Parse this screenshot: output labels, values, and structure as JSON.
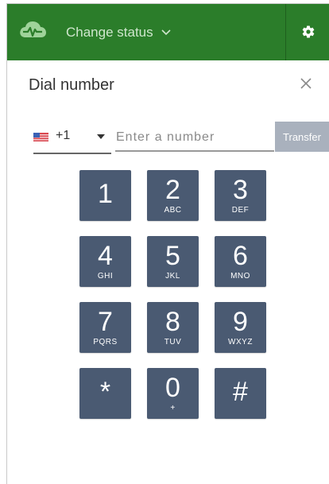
{
  "header": {
    "brand_icon": "cloud-pulse-icon",
    "status_label": "Change status",
    "status_icon": "chevron-down-icon",
    "settings_icon": "gear-icon",
    "accent_color": "#2b7d2a"
  },
  "dialer": {
    "title": "Dial number",
    "close_icon": "close-icon",
    "country_flag": "us-flag-icon",
    "country_code": "+1",
    "number_value": "",
    "number_placeholder": "Enter a number",
    "transfer_label": "Transfer",
    "key_color": "#4a5a72",
    "keys": [
      {
        "digit": "1",
        "letters": ""
      },
      {
        "digit": "2",
        "letters": "ABC"
      },
      {
        "digit": "3",
        "letters": "DEF"
      },
      {
        "digit": "4",
        "letters": "GHI"
      },
      {
        "digit": "5",
        "letters": "JKL"
      },
      {
        "digit": "6",
        "letters": "MNO"
      },
      {
        "digit": "7",
        "letters": "PQRS"
      },
      {
        "digit": "8",
        "letters": "TUV"
      },
      {
        "digit": "9",
        "letters": "WXYZ"
      },
      {
        "digit": "*",
        "letters": ""
      },
      {
        "digit": "0",
        "letters": "+"
      },
      {
        "digit": "#",
        "letters": ""
      }
    ]
  }
}
